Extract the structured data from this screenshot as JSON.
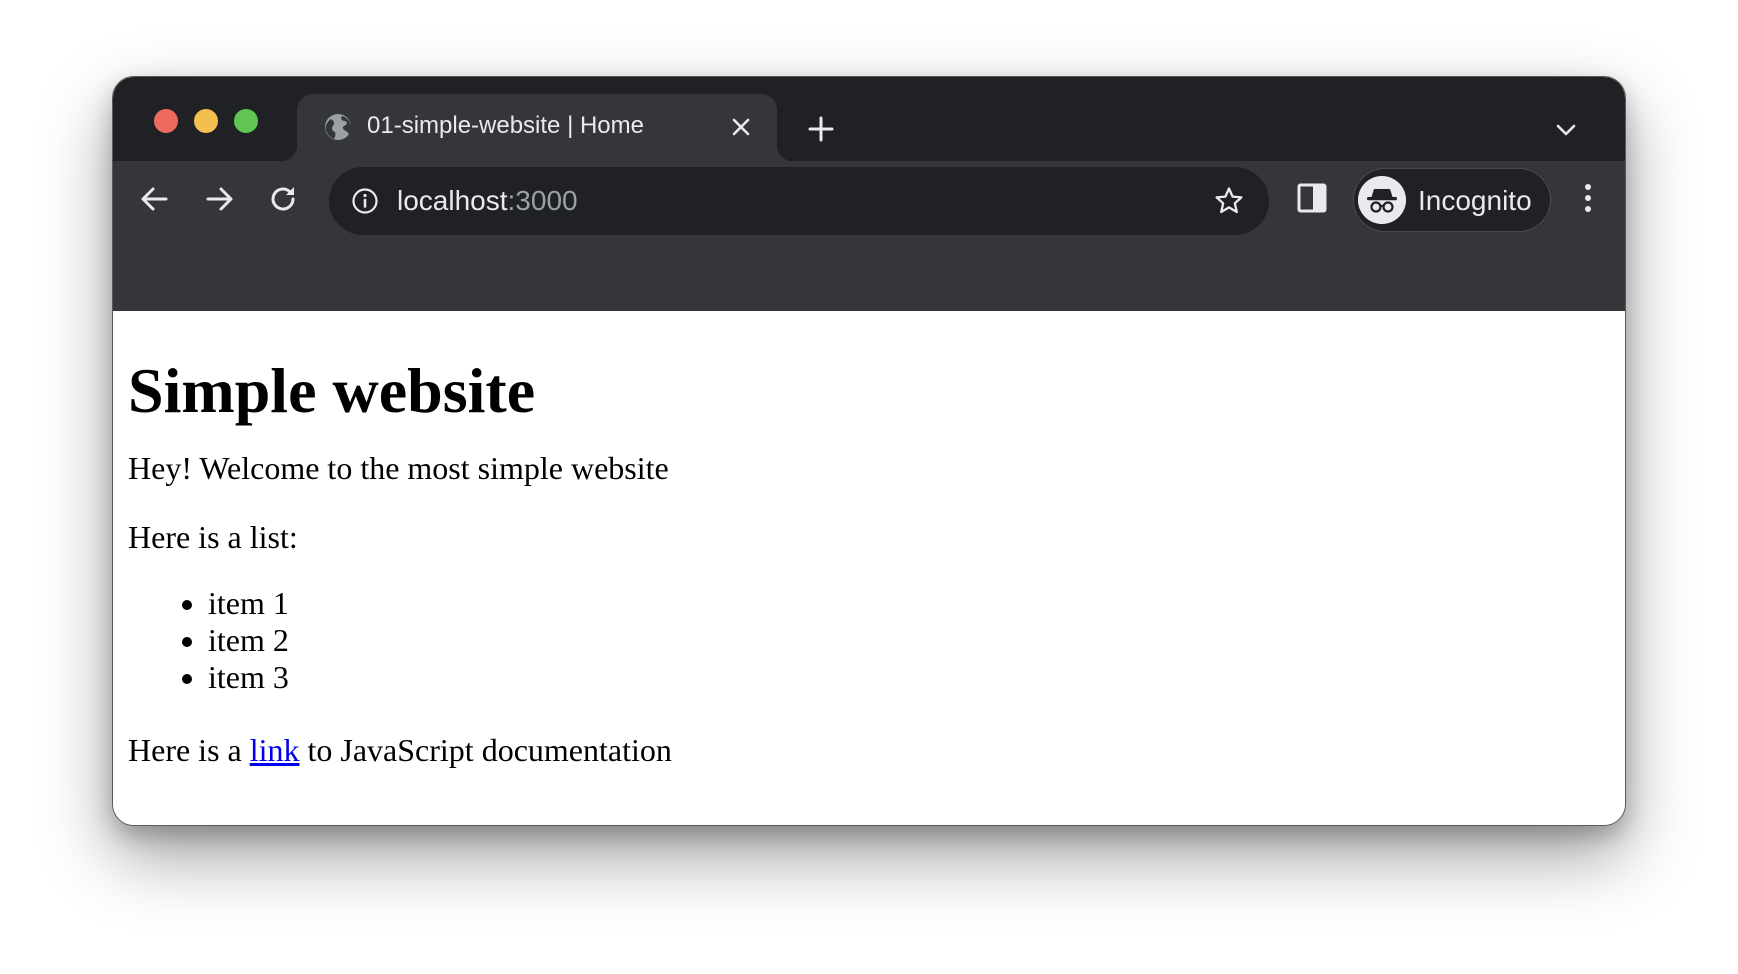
{
  "browser": {
    "tab": {
      "title": "01-simple-website | Home",
      "icon": "globe-icon"
    },
    "address_bar": {
      "host": "localhost",
      "port": ":3000"
    },
    "profile": {
      "label": "Incognito",
      "icon": "incognito-icon"
    },
    "colors": {
      "titlebar": "#202124",
      "toolbar": "#35363a",
      "close": "#ed6a5e",
      "minimize": "#f4bf4f",
      "maximize": "#61c554"
    }
  },
  "page": {
    "heading": "Simple website",
    "welcome": "Hey! Welcome to the most simple website",
    "list_intro": "Here is a list:",
    "list_items": [
      "item 1",
      "item 2",
      "item 3"
    ],
    "link_prefix": "Here is a ",
    "link_text": "link",
    "link_suffix": " to JavaScript documentation",
    "link_color": "#0000ee"
  }
}
